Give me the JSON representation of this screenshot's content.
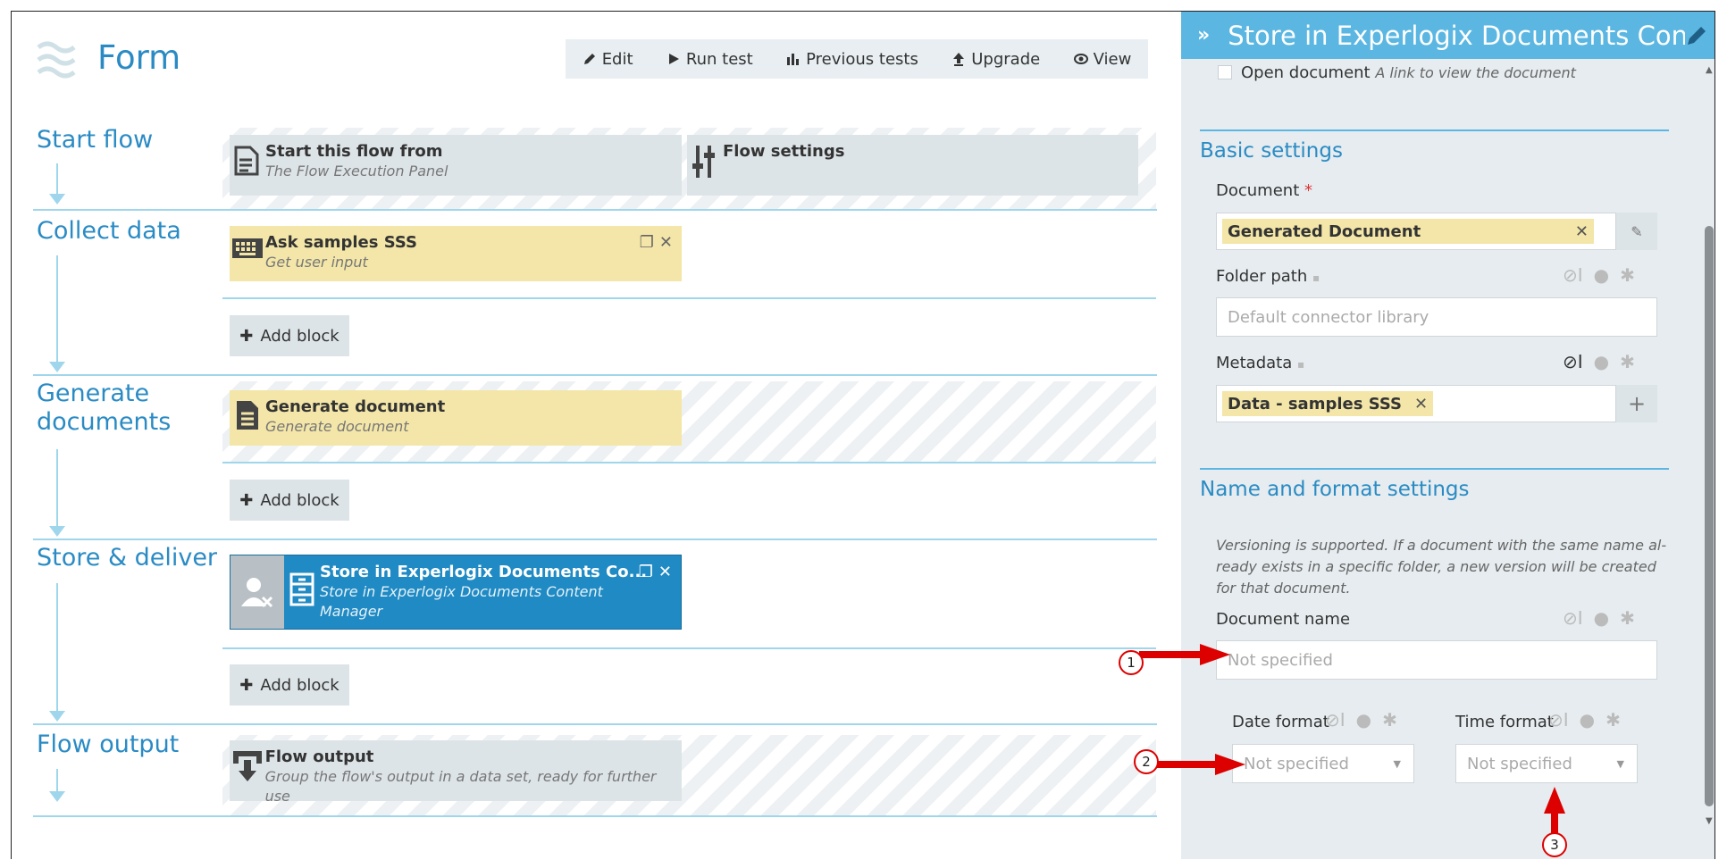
{
  "header": {
    "title": "Form"
  },
  "toolbar": [
    {
      "label": "Edit",
      "icon": "pencil-icon"
    },
    {
      "label": "Run test",
      "icon": "play-icon"
    },
    {
      "label": "Previous tests",
      "icon": "bar-chart-icon"
    },
    {
      "label": "Upgrade",
      "icon": "upgrade-icon"
    },
    {
      "label": "View",
      "icon": "eye-icon"
    }
  ],
  "stages": {
    "start": {
      "title": "Start flow",
      "block1": {
        "title": "Start this flow from",
        "subtitle": "The Flow Execution Panel"
      },
      "block2": {
        "title": "Flow settings"
      }
    },
    "collect": {
      "title": "Collect data",
      "block": {
        "title": "Ask samples SSS",
        "subtitle": "Get user input"
      }
    },
    "generate": {
      "title_line1": "Generate",
      "title_line2": "documents",
      "block": {
        "title": "Generate document",
        "subtitle": "Generate document"
      }
    },
    "store": {
      "title": "Store & deliver",
      "block": {
        "title": "Store in Experlogix Documents Co...",
        "subtitle_line1": "Store in Experlogix Documents Content",
        "subtitle_line2": "Manager"
      }
    },
    "output": {
      "title": "Flow output",
      "block": {
        "title": "Flow output",
        "subtitle": "Group the flow's output in a data set, ready for further use"
      }
    }
  },
  "add_block_label": "Add block",
  "panel": {
    "title": "Store in Experlogix Documents Conte...",
    "open_document": {
      "label": "Open document",
      "hint": "A link to view the document"
    },
    "basic_settings": "Basic settings",
    "document_label": "Document",
    "required_mark": "*",
    "document_value": "Generated Document",
    "folder_path_label": "Folder path",
    "folder_path_placeholder": "Default connector library",
    "metadata_label": "Metadata",
    "metadata_value": "Data - samples SSS",
    "name_format_settings": "Name and format settings",
    "versioning_note_1": "Versioning is supported. If a document with the same name al-",
    "versioning_note_2": "ready exists in a specific folder, a new version will be created",
    "versioning_note_3": "for that document.",
    "document_name_label": "Document name",
    "document_name_placeholder": "Not specified",
    "date_format_label": "Date format",
    "date_format_value": "Not specified",
    "time_format_label": "Time format",
    "time_format_value": "Not specified"
  },
  "callouts": [
    "1",
    "2",
    "3"
  ],
  "colors": {
    "accent": "#2a8bc4",
    "panel_header": "#5bb7e2",
    "selected_block": "#1f8ac3",
    "callout_arrow": "#dd0000"
  }
}
